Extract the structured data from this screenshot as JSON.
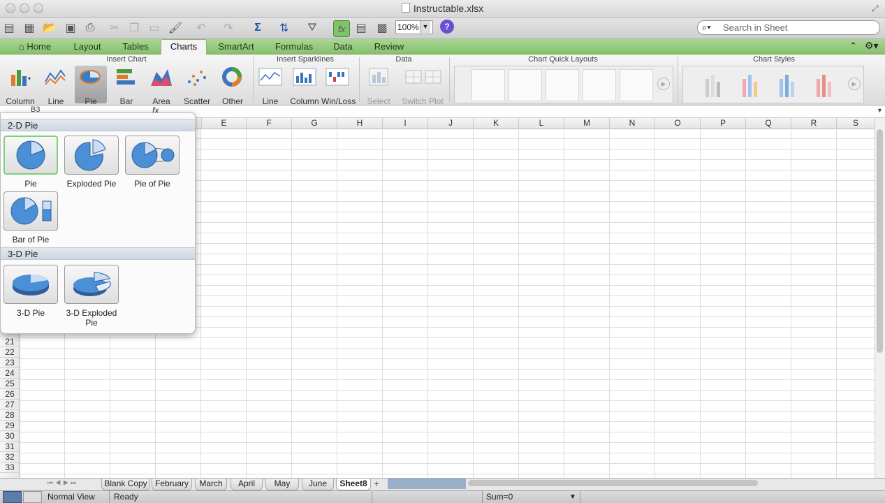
{
  "window": {
    "title": "Instructable.xlsx"
  },
  "toolbar": {
    "zoom": "100%",
    "search_placeholder": "Search in Sheet"
  },
  "tabs": [
    "Home",
    "Layout",
    "Tables",
    "Charts",
    "SmartArt",
    "Formulas",
    "Data",
    "Review"
  ],
  "ribbon": {
    "groups": {
      "insert_chart": "Insert Chart",
      "insert_sparklines": "Insert Sparklines",
      "data": "Data",
      "quick_layouts": "Chart Quick Layouts",
      "chart_styles": "Chart Styles"
    },
    "chart_buttons": [
      "Column",
      "Line",
      "Pie",
      "Bar",
      "Area",
      "Scatter",
      "Other"
    ],
    "sparkline_buttons": [
      "Line",
      "Column",
      "Win/Loss"
    ],
    "data_buttons": [
      "Select",
      "Switch Plot"
    ]
  },
  "formula_bar": {
    "name_box": "B3",
    "fx": "fx"
  },
  "grid": {
    "columns": [
      "E",
      "F",
      "G",
      "H",
      "I",
      "J",
      "K",
      "L",
      "M",
      "N",
      "O",
      "P",
      "Q",
      "R",
      "S"
    ],
    "rows": [
      "21",
      "22",
      "23",
      "24",
      "25",
      "26",
      "27",
      "28",
      "29",
      "30",
      "31",
      "32",
      "33"
    ]
  },
  "pie_menu": {
    "section_2d": "2-D Pie",
    "section_3d": "3-D Pie",
    "options_2d": [
      "Pie",
      "Exploded Pie",
      "Pie of Pie",
      "Bar of Pie"
    ],
    "options_3d": [
      "3-D Pie",
      "3-D Exploded Pie"
    ]
  },
  "sheets": {
    "tabs": [
      "Blank Copy",
      "February",
      "March",
      "April",
      "May",
      "June",
      "Sheet8"
    ],
    "active": "Sheet8",
    "add": "+"
  },
  "status": {
    "view": "Normal View",
    "state": "Ready",
    "sum": "Sum=0"
  }
}
